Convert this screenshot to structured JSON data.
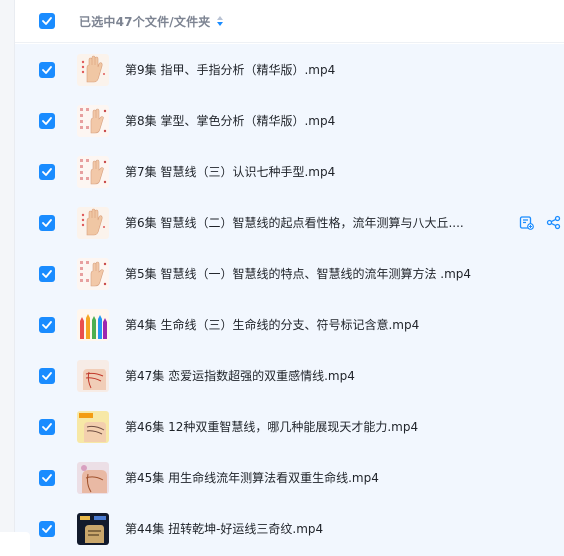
{
  "header": {
    "selection_text": "已选中47个文件/文件夹"
  },
  "colors": {
    "accent": "#1a8cff",
    "list_background": "#f2f7fe"
  },
  "files": [
    {
      "name": "第9集 指甲、手指分析（精华版）.mp4",
      "thumb": "hand-palm"
    },
    {
      "name": "第8集 掌型、掌色分析（精华版）.mp4",
      "thumb": "hand-chart"
    },
    {
      "name": "第7集 智慧线（三）认识七种手型.mp4",
      "thumb": "hand-chart"
    },
    {
      "name": "第6集 智慧线（二）智慧线的起点看性格，流年测算与八大丘....",
      "thumb": "hand-palm",
      "has_actions": true
    },
    {
      "name": "第5集 智慧线（一）智慧线的特点、智慧线的流年测算方法 .mp4",
      "thumb": "hand-chart"
    },
    {
      "name": "第4集 生命线（三）生命线的分支、符号标记含意.mp4",
      "thumb": "colorful-hands"
    },
    {
      "name": "第47集 恋爱运指数超强的双重感情线.mp4",
      "thumb": "palm-lines"
    },
    {
      "name": "第46集 12种双重智慧线，哪几种能展现天才能力.mp4",
      "thumb": "palm-yellow"
    },
    {
      "name": "第45集 用生命线流年测算法看双重生命线.mp4",
      "thumb": "palm-photo"
    },
    {
      "name": "第44集 扭转乾坤-好运线三奇纹.mp4",
      "thumb": "dark-card"
    }
  ],
  "actions": {
    "save_icon": "save-to-drive-icon",
    "share_icon": "share-icon"
  }
}
